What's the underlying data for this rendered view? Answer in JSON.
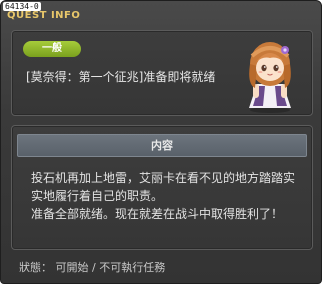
{
  "watermark": "64134-0",
  "window": {
    "title": "QUEST INFO"
  },
  "quest": {
    "category": "一般",
    "name": "[莫奈得：第一个征兆]准备即将就绪"
  },
  "content": {
    "header": "内容",
    "lines": [
      "投石机再加上地雷，艾丽卡在看不见的地方踏踏实",
      "实地履行着自己的职责。",
      "准备全部就绪。现在就差在战斗中取得胜利了！"
    ]
  },
  "status": {
    "text": "狀態： 可開始 / 不可執行任務"
  },
  "colors": {
    "title": "#e8c76a",
    "badge": "#8cb52a",
    "section_header": "#626a73",
    "background": "#3a3a3a"
  }
}
